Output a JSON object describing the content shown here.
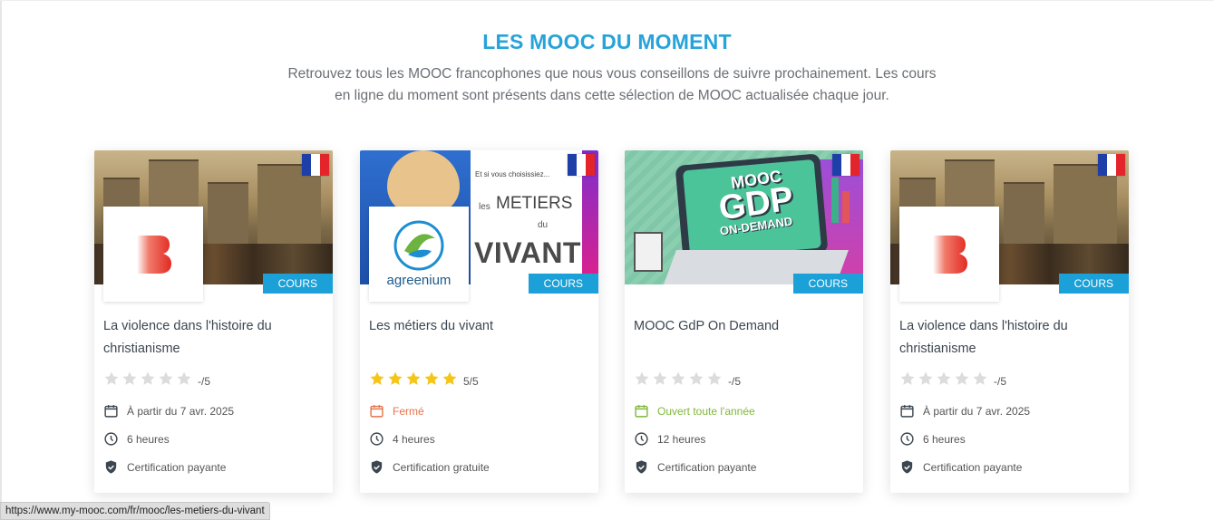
{
  "section": {
    "title": "LES MOOC DU MOMENT",
    "subtitle_line1": "Retrouvez tous les MOOC francophones que nous vous conseillons de suivre prochainement. Les cours",
    "subtitle_line2": "en ligne du moment sont présents dans cette sélection de MOOC actualisée chaque jour."
  },
  "cards": [
    {
      "title_line1": "La violence dans l'histoire du",
      "title_line2": "christianisme",
      "badge": "COURS",
      "rating": "-/5",
      "stars_filled": 0,
      "date": "À partir du 7 avr. 2025",
      "duration": "6 heures",
      "certification": "Certification payante",
      "date_color": "#555555"
    },
    {
      "title_line1": "Les métiers du vivant",
      "title_line2": "",
      "badge": "COURS",
      "rating": "5/5",
      "stars_filled": 5,
      "date": "Fermé",
      "duration": "4 heures",
      "certification": "Certification gratuite",
      "date_color": "#e8724a",
      "logo_text": "agreenium",
      "img_text_small": "Et si vous choisissiez...",
      "img_text_les": "les",
      "img_text_metiers": "METIERS",
      "img_text_du": "du",
      "img_text_vivant": "VIVANT"
    },
    {
      "title_line1": "MOOC GdP On Demand",
      "title_line2": "",
      "badge": "COURS",
      "rating": "-/5",
      "stars_filled": 0,
      "date": "Ouvert toute l'année",
      "duration": "12 heures",
      "certification": "Certification payante",
      "date_color": "#7fb83a",
      "img_text_mooc": "MOOC",
      "img_text_gdp": "GDP",
      "img_text_ondemand": "ON-DEMAND"
    },
    {
      "title_line1": "La violence dans l'histoire du",
      "title_line2": "christianisme",
      "badge": "COURS",
      "rating": "-/5",
      "stars_filled": 0,
      "date": "À partir du 7 avr. 2025",
      "duration": "6 heures",
      "certification": "Certification payante",
      "date_color": "#555555"
    }
  ],
  "status_bar": {
    "url": "https://www.my-mooc.com/fr/mooc/les-metiers-du-vivant"
  },
  "colors": {
    "accent": "#26a3d9",
    "badge": "#1ba0d8",
    "star": "#f5c518",
    "star_empty": "#dcdcdc"
  }
}
